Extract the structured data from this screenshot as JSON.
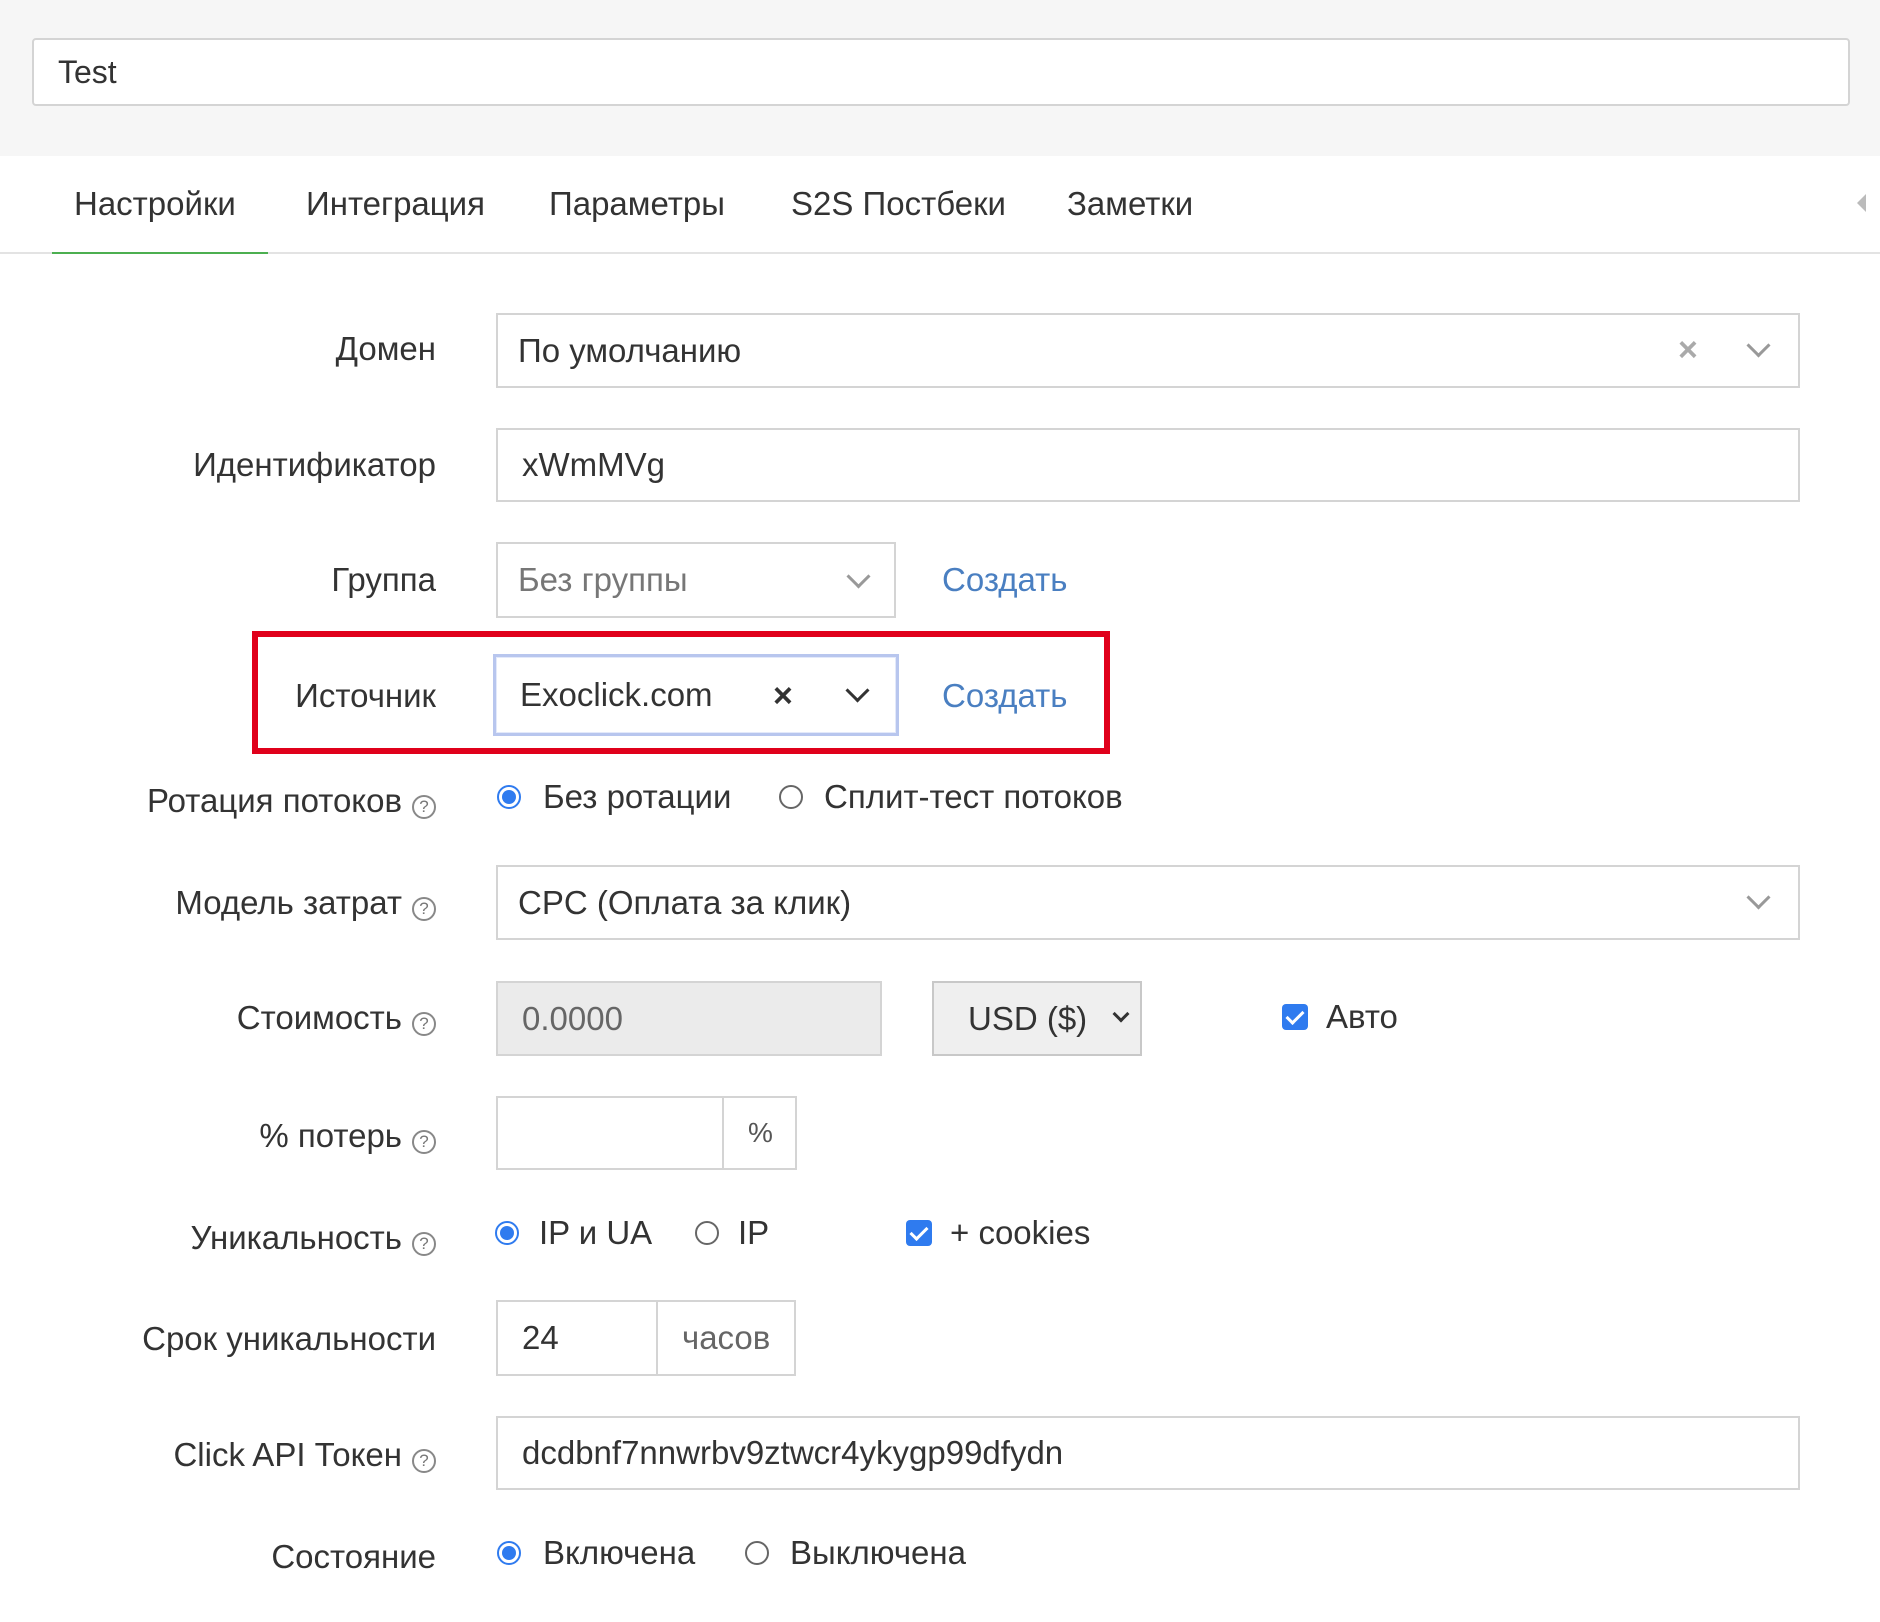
{
  "campaign": {
    "name": "Test"
  },
  "tabs": [
    {
      "label": "Настройки",
      "active": true
    },
    {
      "label": "Интеграция"
    },
    {
      "label": "Параметры"
    },
    {
      "label": "S2S Постбеки"
    },
    {
      "label": "Заметки"
    }
  ],
  "form": {
    "domain": {
      "label": "Домен",
      "value": "По умолчанию"
    },
    "identifier": {
      "label": "Идентификатор",
      "value": "xWmMVg"
    },
    "group": {
      "label": "Группа",
      "value": "Без группы",
      "create": "Создать"
    },
    "source": {
      "label": "Источник",
      "value": "Exoclick.com",
      "create": "Создать"
    },
    "rotation": {
      "label": "Ротация потоков",
      "options": [
        "Без ротации",
        "Сплит-тест потоков"
      ],
      "selected": "Без ротации"
    },
    "cost_model": {
      "label": "Модель затрат",
      "value": "CPC (Оплата за клик)"
    },
    "cost": {
      "label": "Стоимость",
      "value": "0.0000",
      "currency": "USD ($)",
      "auto_label": "Авто",
      "auto_checked": true
    },
    "loss": {
      "label": "% потерь",
      "value": "",
      "addon": "%"
    },
    "uniqueness": {
      "label": "Уникальность",
      "options": [
        "IP и UA",
        "IP"
      ],
      "selected": "IP и UA",
      "cookies_label": "+ cookies",
      "cookies_checked": true
    },
    "uniqueness_period": {
      "label": "Срок уникальности",
      "value": "24",
      "addon": "часов"
    },
    "click_api_token": {
      "label": "Click API Токен",
      "value": "dcdbnf7nnwrbv9ztwcr4ykygp99dfydn"
    },
    "state": {
      "label": "Состояние",
      "options": [
        "Включена",
        "Выключена"
      ],
      "selected": "Включена"
    }
  },
  "colors": {
    "accent": "#2f7bef",
    "link": "#4a7fc1",
    "active_tab": "#4caf50",
    "highlight": "#e0001b"
  }
}
